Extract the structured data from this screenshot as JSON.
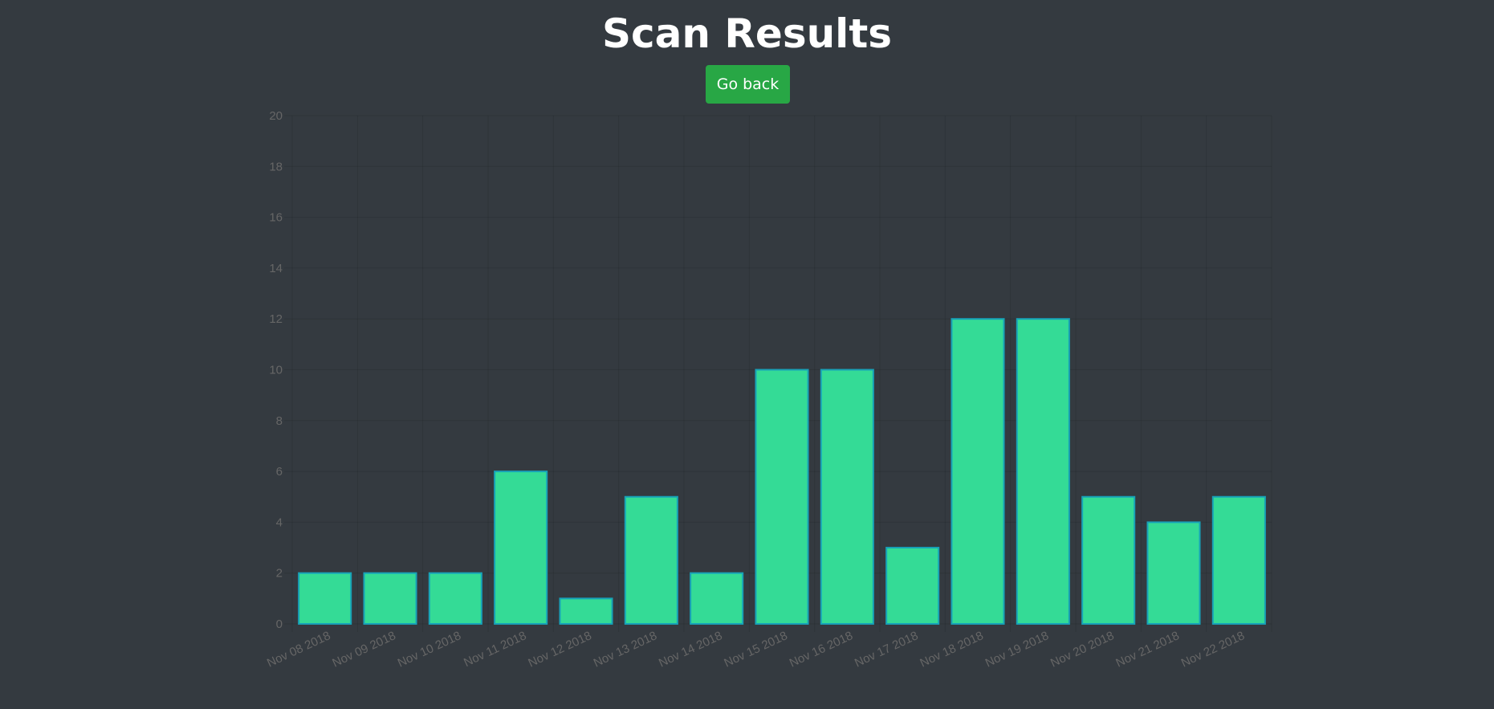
{
  "header": {
    "title": "Scan Results",
    "back_button_label": "Go back"
  },
  "colors": {
    "background": "#343a40",
    "button": "#28a745",
    "bar_fill": "#34db96",
    "bar_border": "#17a2b8",
    "tick_text": "#666666"
  },
  "chart_data": {
    "type": "bar",
    "categories": [
      "Nov 08 2018",
      "Nov 09 2018",
      "Nov 10 2018",
      "Nov 11 2018",
      "Nov 12 2018",
      "Nov 13 2018",
      "Nov 14 2018",
      "Nov 15 2018",
      "Nov 16 2018",
      "Nov 17 2018",
      "Nov 18 2018",
      "Nov 19 2018",
      "Nov 20 2018",
      "Nov 21 2018",
      "Nov 22 2018"
    ],
    "values": [
      2,
      2,
      2,
      6,
      1,
      5,
      2,
      10,
      10,
      3,
      12,
      12,
      5,
      4,
      5
    ],
    "title": "",
    "xlabel": "",
    "ylabel": "",
    "ylim": [
      0,
      20
    ],
    "yticks": [
      "0",
      "2",
      "4",
      "6",
      "8",
      "10",
      "12",
      "14",
      "16",
      "18",
      "20"
    ],
    "grid": true,
    "legend": "none"
  }
}
